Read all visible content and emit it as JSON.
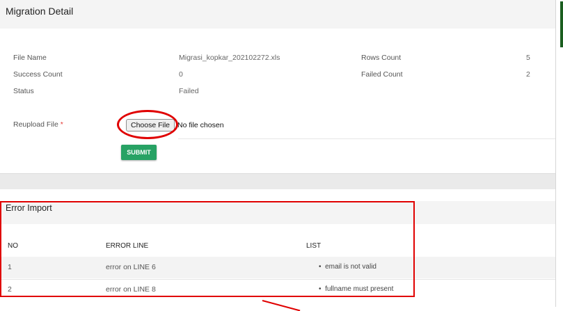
{
  "panel": {
    "title": "Migration Detail"
  },
  "details": {
    "file_name_label": "File Name",
    "file_name_value": "Migrasi_kopkar_202102272.xls",
    "rows_count_label": "Rows Count",
    "rows_count_value": "5",
    "success_count_label": "Success Count",
    "success_count_value": "0",
    "failed_count_label": "Failed Count",
    "failed_count_value": "2",
    "status_label": "Status",
    "status_value": "Failed"
  },
  "reupload": {
    "label": "Reupload File",
    "required_mark": "*",
    "choose_button": "Choose File",
    "no_file_text": "No file chosen",
    "submit_label": "SUBMIT"
  },
  "errors": {
    "title": "Error Import",
    "headers": [
      "NO",
      "ERROR LINE",
      "LIST"
    ],
    "rows": [
      {
        "no": "1",
        "line": "error on LINE 6",
        "items": [
          "email is not valid"
        ]
      },
      {
        "no": "2",
        "line": "error on LINE 8",
        "items": [
          "fullname must present"
        ]
      }
    ]
  },
  "colors": {
    "submit": "#27a264",
    "annotation": "#e00000",
    "required": "#e53935"
  }
}
